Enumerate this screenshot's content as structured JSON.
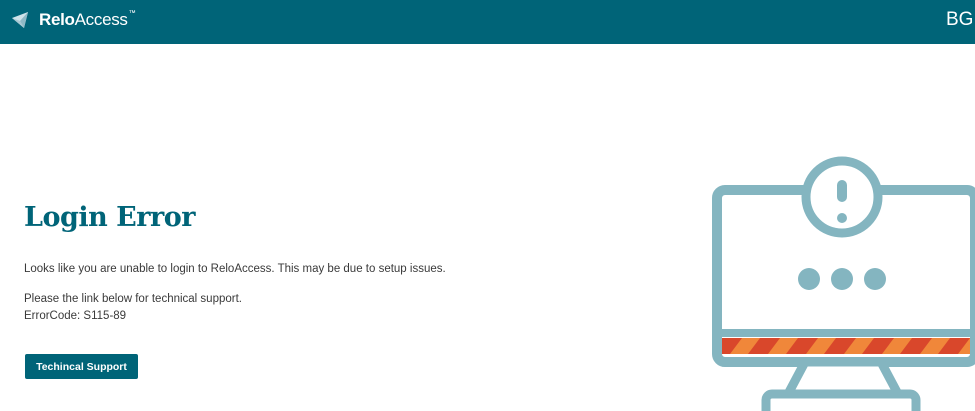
{
  "header": {
    "logo_bold": "Relo",
    "logo_light": "Access",
    "logo_tm": "™",
    "user_initials": "BGF",
    "icons": {
      "logo": "reloaccess-logo-icon"
    },
    "colors": {
      "bar": "#006478",
      "text": "#ffffff"
    }
  },
  "main": {
    "title": "Login Error",
    "message": "Looks like you are unable to login to ReloAccess. This may be due to setup issues.",
    "support_text": "Please the link below for technical support.",
    "error_code": "ErrorCode: S115-89",
    "button_label": "Techincal Support"
  },
  "illustration": {
    "icon": "monitor-error-icon",
    "colors": {
      "outline": "#84b5c0",
      "stripe_red": "#d9472b",
      "stripe_orange": "#f0873a"
    }
  }
}
